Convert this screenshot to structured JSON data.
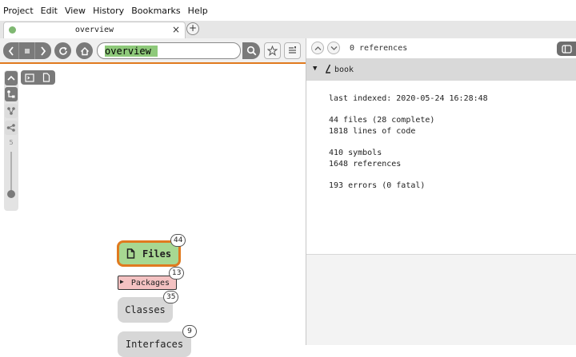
{
  "menu": [
    "Project",
    "Edit",
    "View",
    "History",
    "Bookmarks",
    "Help"
  ],
  "tab": {
    "title": "overview",
    "close": "×",
    "new": "+"
  },
  "toolbar": {
    "search_value": "overview"
  },
  "depth_label": "5",
  "nodes": [
    {
      "label": "Files",
      "count": "44"
    },
    {
      "label": "Packages",
      "count": "13"
    },
    {
      "label": "Classes",
      "count": "35"
    },
    {
      "label": "Interfaces",
      "count": "9"
    }
  ],
  "references": {
    "label": "0 references"
  },
  "book": {
    "name": "book",
    "last_indexed": "last indexed: 2020-05-24 16:28:48",
    "files": "44 files (28 complete)",
    "lines": "1818 lines of code",
    "symbols": "410 symbols",
    "refs": "1648 references",
    "errors": "193 errors (0 fatal)"
  },
  "colors": {
    "accent": "#e07a1f",
    "files_node": "#a7d892",
    "packages_node": "#f4c2c2",
    "search_highlight": "#8ec97a"
  }
}
